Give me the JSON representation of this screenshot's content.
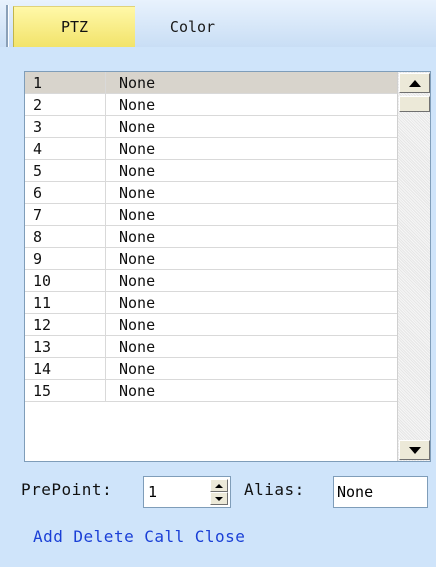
{
  "tabs": [
    {
      "label": "PTZ",
      "active": true
    },
    {
      "label": "Color",
      "active": false
    }
  ],
  "presets": [
    {
      "number": "1",
      "name": "None",
      "selected": true
    },
    {
      "number": "2",
      "name": "None"
    },
    {
      "number": "3",
      "name": "None"
    },
    {
      "number": "4",
      "name": "None"
    },
    {
      "number": "5",
      "name": "None"
    },
    {
      "number": "6",
      "name": "None"
    },
    {
      "number": "7",
      "name": "None"
    },
    {
      "number": "8",
      "name": "None"
    },
    {
      "number": "9",
      "name": "None"
    },
    {
      "number": "10",
      "name": "None"
    },
    {
      "number": "11",
      "name": "None"
    },
    {
      "number": "12",
      "name": "None"
    },
    {
      "number": "13",
      "name": "None"
    },
    {
      "number": "14",
      "name": "None"
    },
    {
      "number": "15",
      "name": "None"
    }
  ],
  "form": {
    "prepoint_label": "PrePoint:",
    "prepoint_value": "1",
    "alias_label": "Alias:",
    "alias_value": "None"
  },
  "actions": {
    "add": "Add",
    "delete": "Delete",
    "call": "Call",
    "close": "Close"
  },
  "colors": {
    "background": "#cfe4fa",
    "active_tab": "#f2e36a",
    "link": "#1a3fd6",
    "selected_row": "#d8d4cc"
  }
}
